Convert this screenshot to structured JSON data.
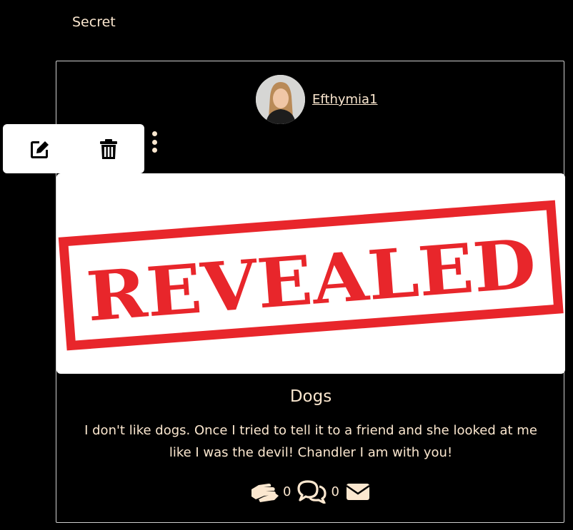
{
  "category": {
    "label": "Secret"
  },
  "post": {
    "author": {
      "name": "Efthymia1"
    },
    "menu": {
      "icons": [
        "edit-icon",
        "trash-icon"
      ],
      "kebab_icon": "kebab-icon"
    },
    "image": {
      "stamp_text": "REVEALED"
    },
    "title": "Dogs",
    "content": "I don't like dogs. Once I tried to tell it to a friend and she looked at me like I was the devil! Chandler I am with you!",
    "stats": {
      "support_icon": "handshake-icon",
      "support_count": "0",
      "comments_icon": "comments-icon",
      "comments_count": "0",
      "message_icon": "envelope-icon"
    }
  },
  "colors": {
    "background": "#000000",
    "text": "#fbe7cf",
    "stamp_red": "#e8262b"
  }
}
